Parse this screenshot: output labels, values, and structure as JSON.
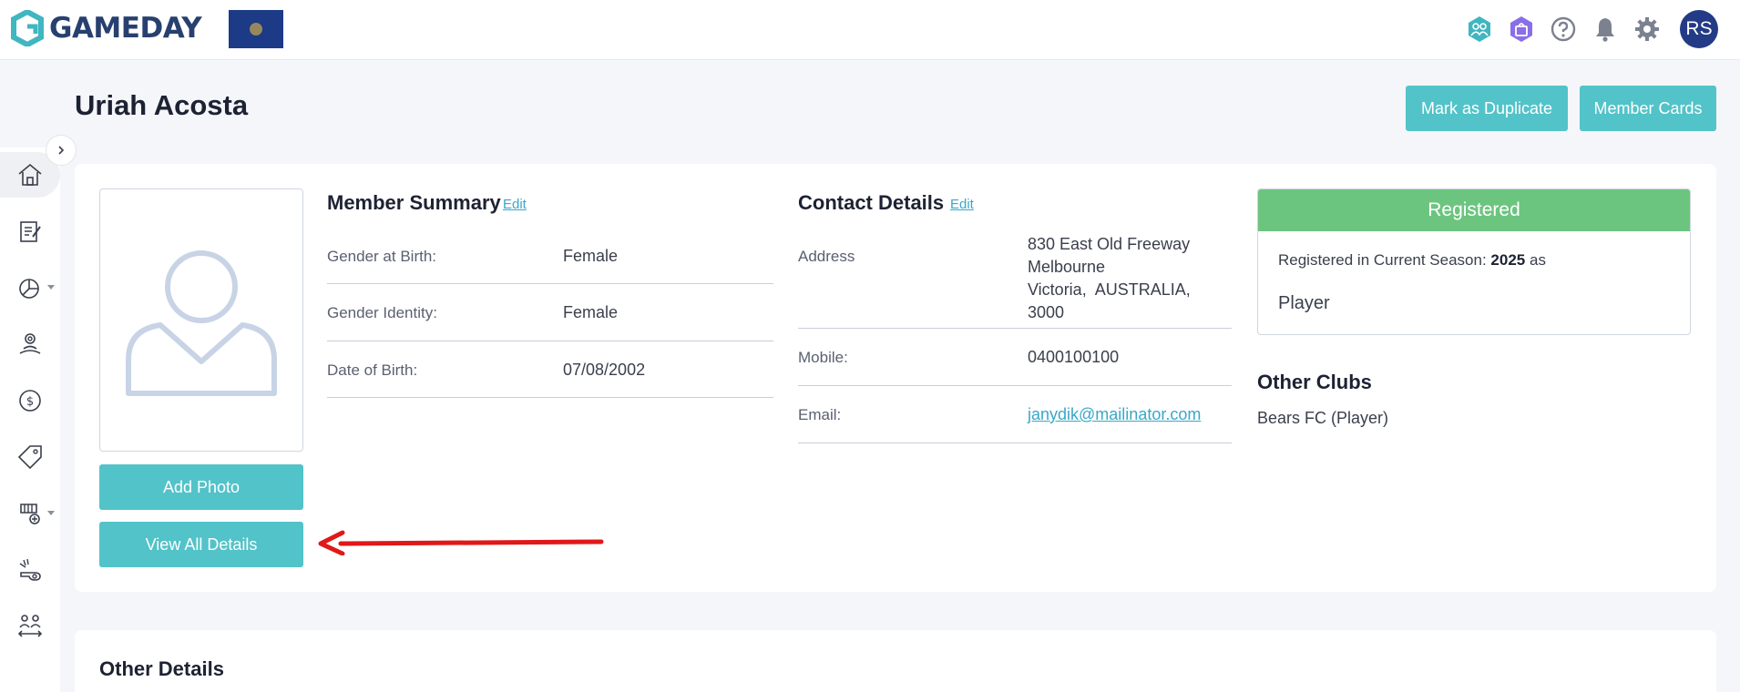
{
  "brand": {
    "name": "GAMEDAY",
    "accent": "#52c3c8",
    "navy": "#233b86",
    "registered_color": "#6cc57f"
  },
  "header": {
    "icons": [
      "members-icon",
      "shop-icon",
      "help-icon",
      "bell-icon",
      "gear-icon"
    ],
    "avatar_initials": "RS"
  },
  "sidebar": {
    "items": [
      "home-icon",
      "forms-icon",
      "reports-icon",
      "registrations-icon",
      "finance-icon",
      "promotions-icon",
      "membership-icon",
      "competition-icon",
      "transfers-icon"
    ]
  },
  "page": {
    "title": "Uriah Acosta",
    "mark_duplicate_label": "Mark as Duplicate",
    "member_cards_label": "Member Cards"
  },
  "photo": {
    "add_photo_label": "Add Photo",
    "view_all_label": "View All Details"
  },
  "summary": {
    "title": "Member Summary",
    "edit_label": "Edit",
    "fields": [
      {
        "label": "Gender at Birth:",
        "value": "Female"
      },
      {
        "label": "Gender Identity:",
        "value": "Female"
      },
      {
        "label": "Date of Birth:",
        "value": "07/08/2002"
      }
    ]
  },
  "contact": {
    "title": "Contact Details",
    "edit_label": "Edit",
    "address_label": "Address",
    "address_lines": [
      "830 East Old Freeway",
      "Melbourne",
      "Victoria,  AUSTRALIA,",
      "3000"
    ],
    "mobile_label": "Mobile:",
    "mobile_value": "0400100100",
    "email_label": "Email:",
    "email_value": "janydik@mailinator.com"
  },
  "registration": {
    "status": "Registered",
    "line_prefix": "Registered in Current Season:",
    "season": "2025",
    "line_suffix": "as",
    "role": "Player"
  },
  "other_clubs": {
    "title": "Other Clubs",
    "value": "Bears FC (Player)"
  },
  "other_details": {
    "title": "Other Details"
  }
}
